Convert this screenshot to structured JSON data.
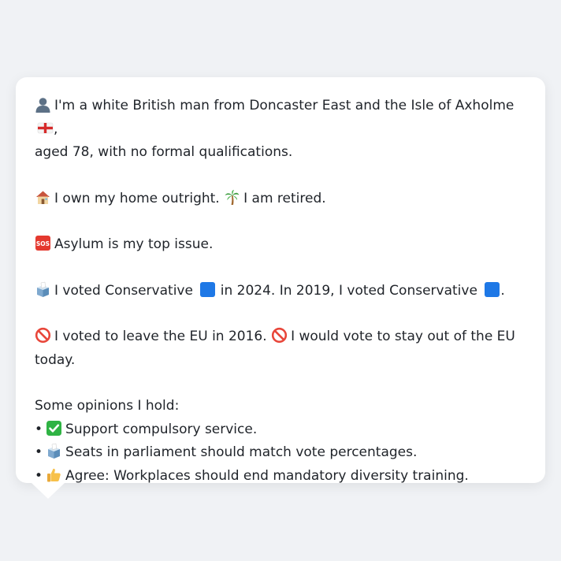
{
  "profile": {
    "line1_a": "I'm a white British man from Doncaster East and the Isle of Axholme",
    "line1_b": ",",
    "line1_c": "aged 78, with no formal qualifications.",
    "home": "I own my home outright.",
    "retired": "I am retired.",
    "issue": "Asylum is my top issue.",
    "vote_a": "I voted Conservative",
    "vote_b": "in 2024. In 2019, I voted Conservative",
    "vote_c": ".",
    "eu_a": "I voted to leave the EU in 2016.",
    "eu_b": "I would vote to stay out of the EU",
    "eu_c": "today.",
    "opinions_header": "Some opinions I hold:",
    "bullet_char": "•",
    "opinions": [
      "Support compulsory service.",
      "Seats in parliament should match vote percentages.",
      "Agree: Workplaces should end mandatory diversity training."
    ]
  },
  "icons": {
    "person": "person-icon",
    "flag": "england-flag-icon",
    "house": "house-icon",
    "palm": "palm-tree-icon",
    "sos": "sos-icon",
    "ballot": "ballot-box-icon",
    "blue_square": "blue-square-icon",
    "prohibited": "prohibited-icon",
    "check": "check-mark-icon",
    "thumbs_up": "thumbs-up-icon"
  },
  "colors": {
    "background": "#f0f2f5",
    "card": "#ffffff",
    "text": "#1f2329",
    "conservative_blue": "#1e78e6",
    "prohibited_red": "#e8463a",
    "check_green": "#2fb344"
  }
}
